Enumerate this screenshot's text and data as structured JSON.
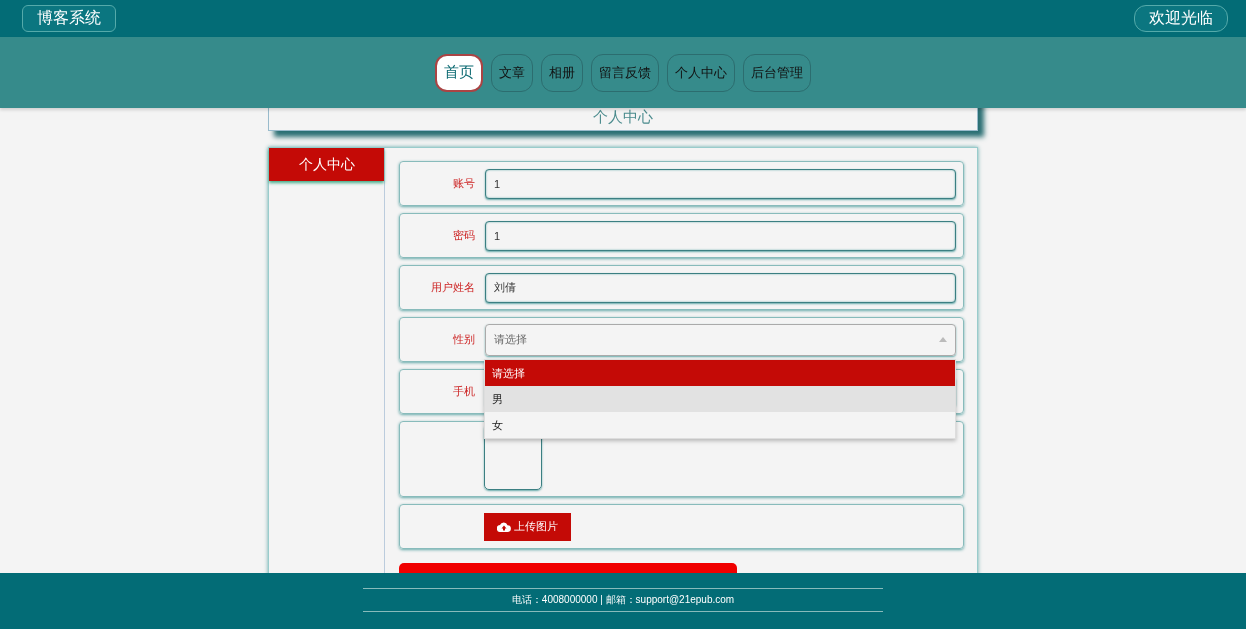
{
  "header": {
    "logo": "博客系统",
    "welcome": "欢迎光临"
  },
  "nav": [
    {
      "label": "首页",
      "selected": true
    },
    {
      "label": "文章",
      "selected": false
    },
    {
      "label": "相册",
      "selected": false
    },
    {
      "label": "留言反馈",
      "selected": false
    },
    {
      "label": "个人中心",
      "selected": false
    },
    {
      "label": "后台管理",
      "selected": false
    }
  ],
  "page_title": "个人中心",
  "sidebar": {
    "title": "个人中心"
  },
  "form": [
    {
      "kind": "text",
      "label": "账号",
      "value": "1"
    },
    {
      "kind": "text",
      "label": "密码",
      "value": "1"
    },
    {
      "kind": "text",
      "label": "用户姓名",
      "value": "刘倩"
    },
    {
      "kind": "select",
      "label": "性别",
      "value": "请选择",
      "expanded": true,
      "options": [
        {
          "label": "请选择",
          "selected": true,
          "hovered": false
        },
        {
          "label": "男",
          "selected": false,
          "hovered": true
        },
        {
          "label": "女",
          "selected": false,
          "hovered": false
        }
      ]
    },
    {
      "kind": "text",
      "label": "手机"
    },
    {
      "kind": "image"
    },
    {
      "kind": "upload",
      "button": "上传图片"
    }
  ],
  "footer": {
    "contact": "电话：4008000000 | 邮箱：support@21epub.com"
  }
}
